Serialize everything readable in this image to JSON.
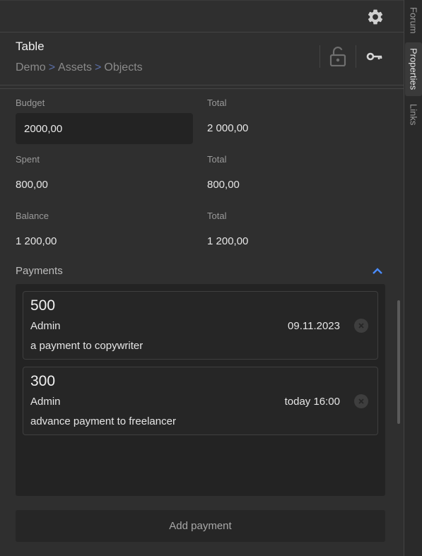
{
  "header": {
    "title": "Table",
    "breadcrumb": [
      "Demo",
      "Assets",
      "Objects"
    ],
    "separator": ">",
    "icons": {
      "settings": "gear-icon",
      "lock": "lock-open-icon",
      "key": "key-icon"
    }
  },
  "fields": {
    "budget": {
      "label": "Budget",
      "value": "2000,00",
      "total_label": "Total",
      "total_value": "2 000,00"
    },
    "spent": {
      "label": "Spent",
      "value": "800,00",
      "total_label": "Total",
      "total_value": "800,00"
    },
    "balance": {
      "label": "Balance",
      "value": "1 200,00",
      "total_label": "Total",
      "total_value": "1 200,00"
    }
  },
  "payments": {
    "title": "Payments",
    "items": [
      {
        "amount": "500",
        "user": "Admin",
        "date": "09.11.2023",
        "note": "a payment to copywriter"
      },
      {
        "amount": "300",
        "user": "Admin",
        "date": "today 16:00",
        "note": "advance payment to freelancer"
      }
    ],
    "add_label": "Add payment"
  },
  "side_tabs": [
    "Forum",
    "Properties",
    "Links"
  ],
  "active_tab": "Properties",
  "colors": {
    "accent": "#4a8cff",
    "background": "#2f2f2f",
    "input": "#232323"
  }
}
